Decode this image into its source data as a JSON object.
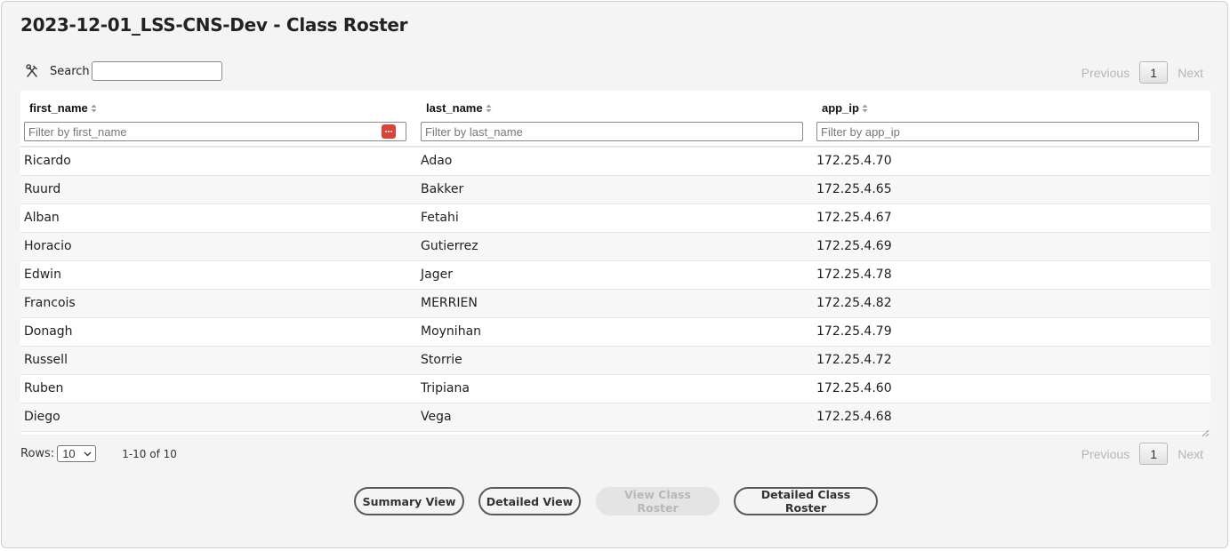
{
  "page": {
    "title": "2023-12-01_LSS-CNS-Dev - Class Roster"
  },
  "toolbar": {
    "tools_icon": "hammer-wrench-icon",
    "search_label": "Search",
    "search_value": ""
  },
  "pagination": {
    "previous": "Previous",
    "next": "Next",
    "current": "1"
  },
  "table": {
    "columns": [
      {
        "label": "first_name",
        "filter_placeholder": "Filter by first_name"
      },
      {
        "label": "last_name",
        "filter_placeholder": "Filter by last_name"
      },
      {
        "label": "app_ip",
        "filter_placeholder": "Filter by app_ip"
      }
    ],
    "rows": [
      [
        "Ricardo",
        "Adao",
        "172.25.4.70"
      ],
      [
        "Ruurd",
        "Bakker",
        "172.25.4.65"
      ],
      [
        "Alban",
        "Fetahi",
        "172.25.4.67"
      ],
      [
        "Horacio",
        "Gutierrez",
        "172.25.4.69"
      ],
      [
        "Edwin",
        "Jager",
        "172.25.4.78"
      ],
      [
        "Francois",
        "MERRIEN",
        "172.25.4.82"
      ],
      [
        "Donagh",
        "Moynihan",
        "172.25.4.79"
      ],
      [
        "Russell",
        "Storrie",
        "172.25.4.72"
      ],
      [
        "Ruben",
        "Tripiana",
        "172.25.4.60"
      ],
      [
        "Diego",
        "Vega",
        "172.25.4.68"
      ]
    ]
  },
  "footer": {
    "rows_label": "Rows:",
    "rows_value": "10",
    "count_text": "1-10 of 10"
  },
  "actions": {
    "summary": "Summary View",
    "detailed": "Detailed View",
    "roster": "View Class Roster",
    "detailed_roster": "Detailed Class Roster"
  },
  "colors": {
    "panel_bg": "#f4f4f4",
    "button_border": "#5a5a5a",
    "disabled_text": "#b8b8b8",
    "password_manager_icon": "#d9433a"
  }
}
